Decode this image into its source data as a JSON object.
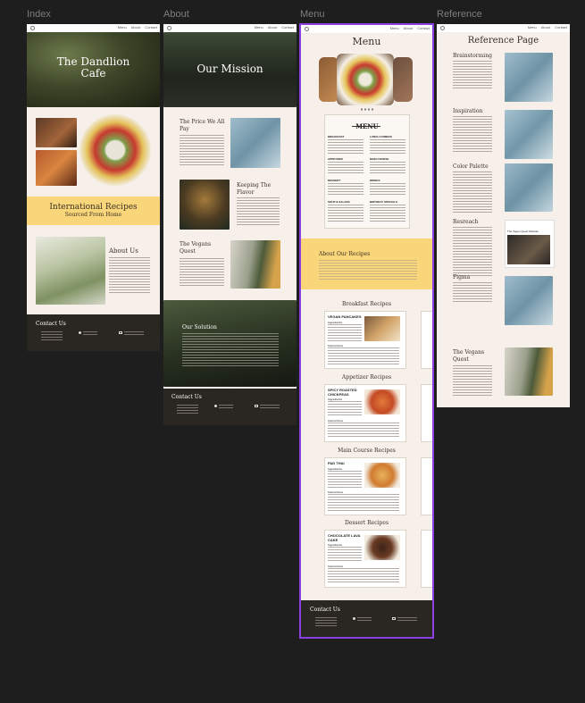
{
  "frame_labels": {
    "index": "Index",
    "about": "About",
    "menu": "Menu",
    "reference": "Reference"
  },
  "nav": {
    "links": [
      "Menu",
      "About",
      "Contact"
    ]
  },
  "index": {
    "hero_title_1": "The Dandlion",
    "hero_title_2": "Cafe",
    "banner_title": "International Recipes",
    "banner_subtitle": "Sourced From Home",
    "about_title": "About Us",
    "contact_title": "Contact Us"
  },
  "about": {
    "hero_title": "Our Mission",
    "price_title_1": "The Price We All",
    "price_title_2": "Pay",
    "flavor_title_1": "Keeping The",
    "flavor_title_2": "Flavor",
    "vegans_title_1": "The Vegans",
    "vegans_title_2": "Quest",
    "solution_title": "Our Solution",
    "contact_title": "Contact Us"
  },
  "menu": {
    "title": "Menu",
    "card_title": "MENU",
    "sections": [
      "BREAKFAST",
      "LUNCH COMBOS",
      "APPETIZER",
      "MAIN COURSE",
      "DESSERT",
      "DRINKS",
      "SOUP & SALADS",
      "BIRTHDAY SPECIALS"
    ],
    "about_recipes_title": "About Our Recipes",
    "categories": [
      "Breakfast Recipes",
      "Appetizer Recipes",
      "Main Course Recipes",
      "Dessert Recipes"
    ],
    "recipes": [
      "VEGAN PANCAKES",
      "SPICY ROASTED CHICKPEAS",
      "PAD THAI",
      "CHOCOLATE LAVA CAKE"
    ],
    "ingredients_label": "Ingredients",
    "instructions_label": "Instructions",
    "contact_title": "Contact Us"
  },
  "reference": {
    "title": "Reference Page",
    "items": [
      "Brainstorming",
      "Inspiration",
      "Color Palette",
      "Resreach",
      "Figma",
      "The Vegans Quest"
    ],
    "research_shot_title": "The Vegan Quest Website"
  },
  "colors": {
    "canvas": "#1e1e1e",
    "page": "#f7f0ea",
    "banner": "#f9d67a",
    "footer": "#2a2723",
    "selection": "#8b41e0"
  }
}
